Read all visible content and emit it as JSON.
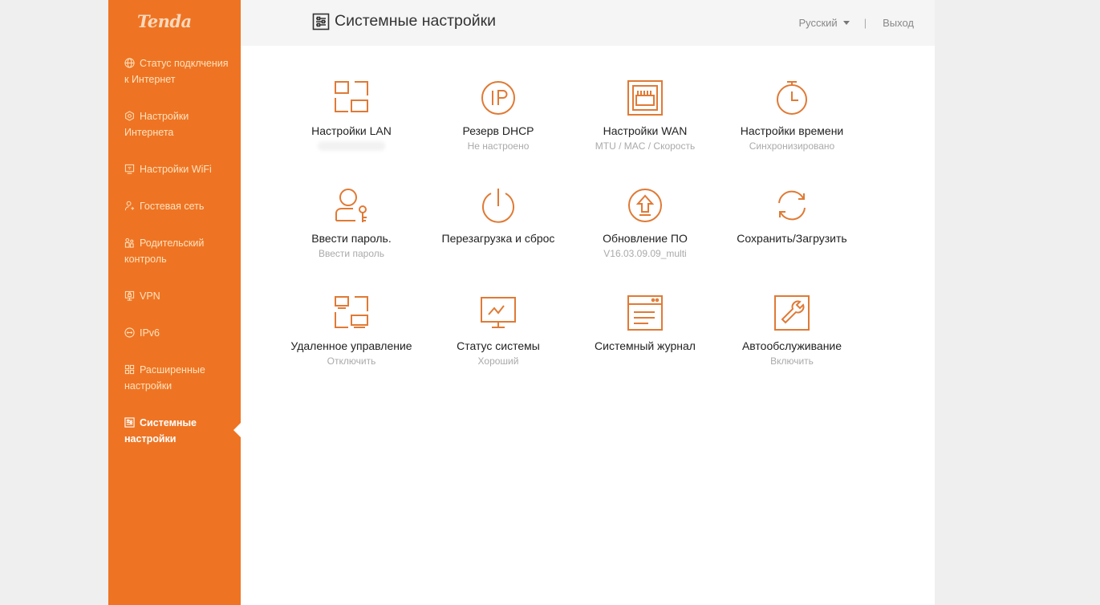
{
  "brand": {
    "logo_text": "Tenda",
    "accent": "#ee7423"
  },
  "sidebar": {
    "items": [
      {
        "label": "Статус подклчения к Интернет",
        "icon": "globe-icon"
      },
      {
        "label": "Настройки Интернета",
        "icon": "gear-hex-icon"
      },
      {
        "label": "Настройки WiFi",
        "icon": "wifi-screen-icon"
      },
      {
        "label": "Гостевая сеть",
        "icon": "guest-user-icon"
      },
      {
        "label": "Родительский контроль",
        "icon": "parental-icon"
      },
      {
        "label": "VPN",
        "icon": "vpn-icon"
      },
      {
        "label": "IPv6",
        "icon": "ipv6-icon"
      },
      {
        "label": "Расширенные настройки",
        "icon": "grid-icon"
      },
      {
        "label": "Системные настройки",
        "icon": "system-settings-icon",
        "active": true
      }
    ]
  },
  "header": {
    "title": "Системные настройки",
    "language": "Русский",
    "separator": "|",
    "logout": "Выход"
  },
  "tiles": [
    {
      "title": "Настройки LAN",
      "subtitle": "",
      "icon": "lan-icon"
    },
    {
      "title": "Резерв DHCP",
      "subtitle": "Не настроено",
      "icon": "ip-icon"
    },
    {
      "title": "Настройки WAN",
      "subtitle": "MTU / MAC / Скорость",
      "icon": "ethernet-port-icon"
    },
    {
      "title": "Настройки времени",
      "subtitle": "Синхронизировано",
      "icon": "stopwatch-icon"
    },
    {
      "title": "Ввести пароль.",
      "subtitle": "Ввести пароль",
      "icon": "user-key-icon"
    },
    {
      "title": "Перезагрузка и сброс",
      "subtitle": "",
      "icon": "power-icon"
    },
    {
      "title": "Обновление ПО",
      "subtitle": "V16.03.09.09_multi",
      "icon": "upgrade-icon"
    },
    {
      "title": "Сохранить/Загрузить",
      "subtitle": "",
      "icon": "sync-icon"
    },
    {
      "title": "Удаленное управление",
      "subtitle": "Отключить",
      "icon": "remote-icon"
    },
    {
      "title": "Статус системы",
      "subtitle": "Хороший",
      "icon": "monitor-icon"
    },
    {
      "title": "Системный журнал",
      "subtitle": "",
      "icon": "log-icon"
    },
    {
      "title": "Автообслуживание",
      "subtitle": "Включить",
      "icon": "wrench-icon"
    }
  ]
}
